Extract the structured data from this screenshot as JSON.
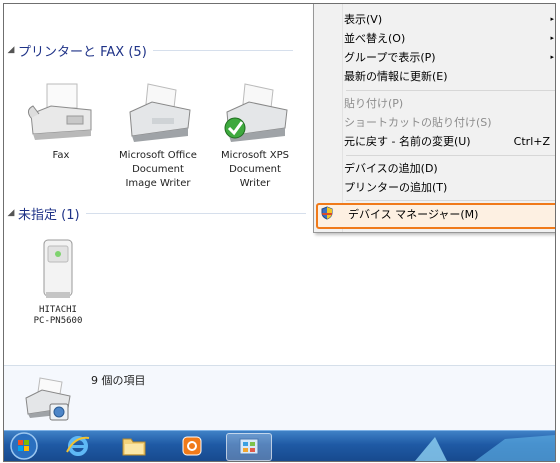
{
  "groups": {
    "printers": {
      "title": "プリンターと FAX (5)"
    },
    "unspecified": {
      "title": "未指定 (1)"
    }
  },
  "devices": {
    "fax": {
      "label": "Fax"
    },
    "office_writer": {
      "label": "Microsoft Office\nDocument\nImage Writer"
    },
    "xps_writer": {
      "label": "Microsoft XPS\nDocument\nWriter"
    },
    "hitachi": {
      "label": "HITACHI\nPC-PN5600"
    }
  },
  "context_menu": {
    "view": "表示(V)",
    "sort_by": "並べ替え(O)",
    "group_by": "グループで表示(P)",
    "refresh": "最新の情報に更新(E)",
    "paste": "貼り付け(P)",
    "paste_shortcut": "ショートカットの貼り付け(S)",
    "undo_rename": "元に戻す - 名前の変更(U)",
    "undo_shortcut": "Ctrl+Z",
    "add_device": "デバイスの追加(D)",
    "add_printer": "プリンターの追加(T)",
    "device_manager": "デバイス マネージャー(M)",
    "submenu_arrow": "▸"
  },
  "status_bar": {
    "item_count": "9 個の項目"
  },
  "colors": {
    "highlight_border": "#f07a1a",
    "group_title": "#1e3287",
    "taskbar": "#1f5aa5"
  },
  "icons": [
    "fax-icon",
    "printer-icon",
    "check-icon",
    "shield-icon",
    "start-orb-icon",
    "ie-icon",
    "explorer-icon",
    "media-player-icon",
    "control-panel-icon"
  ]
}
